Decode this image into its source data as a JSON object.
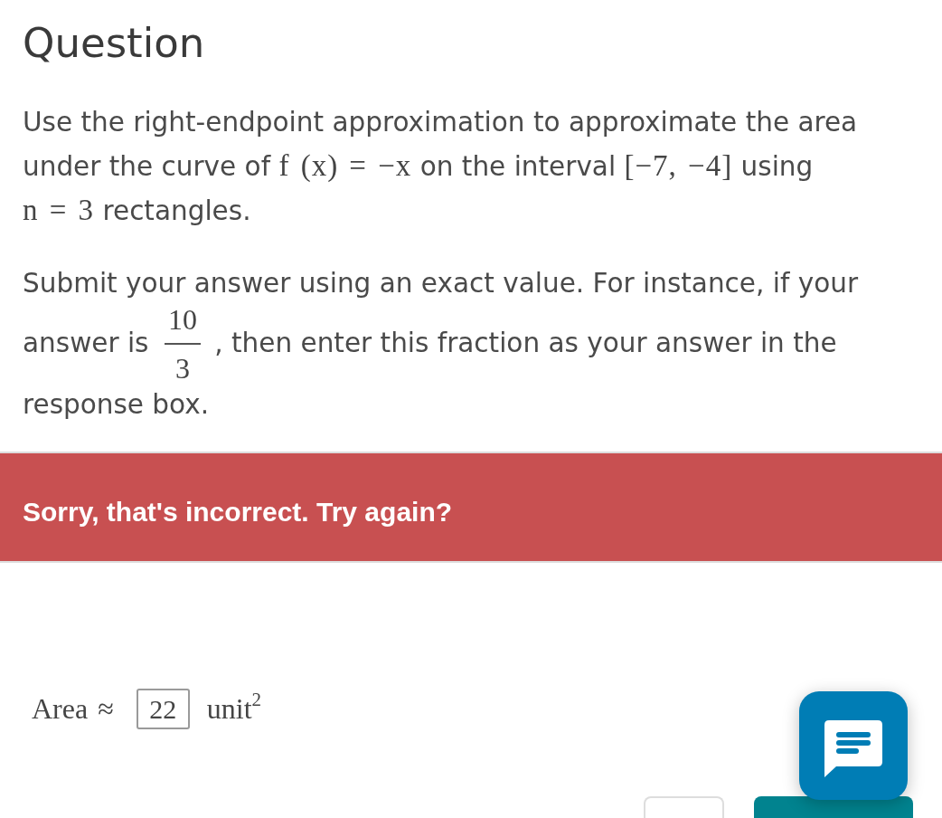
{
  "heading": {
    "text": "Question"
  },
  "question": {
    "paragraphs": [
      {
        "segments": [
          {
            "kind": "text",
            "text": "Use the right-endpoint approximation to approximate the area under the curve of "
          },
          {
            "kind": "math",
            "text": "f (x) = −x"
          },
          {
            "kind": "text",
            "text": " on the interval "
          },
          {
            "kind": "math",
            "text": "[−7, −4]"
          },
          {
            "kind": "text",
            "text": " using "
          },
          {
            "kind": "math",
            "text": "n = 3"
          },
          {
            "kind": "text",
            "text": " rectangles."
          }
        ]
      },
      {
        "segments": [
          {
            "kind": "text",
            "text": "Submit your answer using an exact value. For instance, if your answer is "
          },
          {
            "kind": "fraction",
            "numerator": "10",
            "denominator": "3"
          },
          {
            "kind": "text",
            "text": " , then enter this fraction as your answer in the response box."
          }
        ]
      }
    ]
  },
  "feedback": {
    "kind": "incorrect",
    "text": "Sorry, that's incorrect. Try again?"
  },
  "answer": {
    "label": "Area ≈",
    "value": "22",
    "unit": "unit$^{2}$"
  }
}
